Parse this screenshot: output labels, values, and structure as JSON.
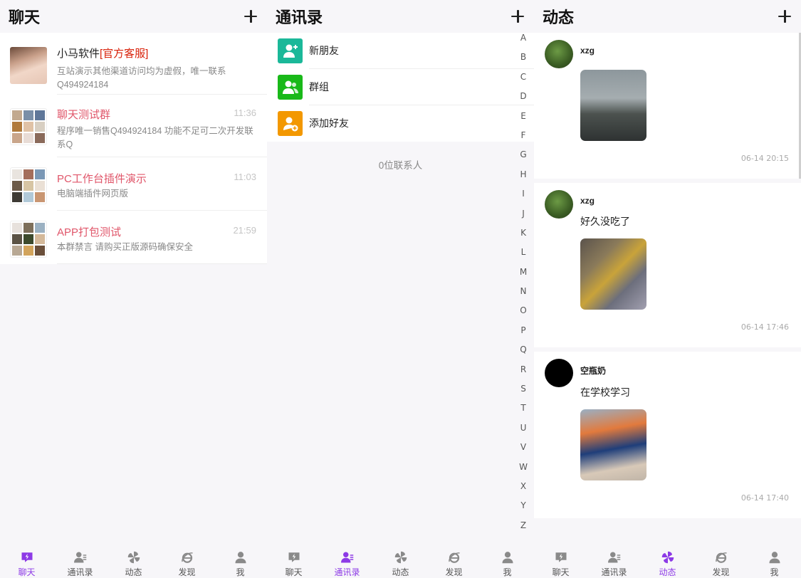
{
  "chat": {
    "title": "聊天",
    "items": [
      {
        "name": "小马软件",
        "tag": "[官方客服]",
        "time": "",
        "msg": "互站演示其他渠道访问均为虚假，唯一联系Q494924184"
      },
      {
        "name": "聊天测试群",
        "tag": "",
        "time": "11:36",
        "msg": "程序唯一销售Q494924184 功能不足可二次开发联系Q"
      },
      {
        "name": "PC工作台插件演示",
        "tag": "",
        "time": "11:03",
        "msg": "电脑端插件网页版"
      },
      {
        "name": "APP打包测试",
        "tag": "",
        "time": "21:59",
        "msg": "本群禁言 请购买正版源码确保安全"
      }
    ]
  },
  "contacts": {
    "title": "通讯录",
    "rows": [
      {
        "label": "新朋友",
        "icon": "new-friend-icon",
        "color": "#1bb899"
      },
      {
        "label": "群组",
        "icon": "group-icon",
        "color": "#19b919"
      },
      {
        "label": "添加好友",
        "icon": "add-friend-icon",
        "color": "#f39800"
      }
    ],
    "count": "0位联系人",
    "letters": [
      "A",
      "B",
      "C",
      "D",
      "E",
      "F",
      "G",
      "H",
      "I",
      "J",
      "K",
      "L",
      "M",
      "N",
      "O",
      "P",
      "Q",
      "R",
      "S",
      "T",
      "U",
      "V",
      "W",
      "X",
      "Y",
      "Z"
    ]
  },
  "moments": {
    "title": "动态",
    "posts": [
      {
        "user": "xzg",
        "text": "",
        "time": "06-14 20:15"
      },
      {
        "user": "xzg",
        "text": "好久没吃了",
        "time": "06-14 17:46"
      },
      {
        "user": "空瓶奶",
        "text": "在学校学习",
        "time": "06-14 17:40"
      }
    ]
  },
  "nav": [
    "聊天",
    "通讯录",
    "动态",
    "发现",
    "我"
  ],
  "colors": {
    "active": "#8d3ae6",
    "inactive": "#8a8a8a"
  }
}
